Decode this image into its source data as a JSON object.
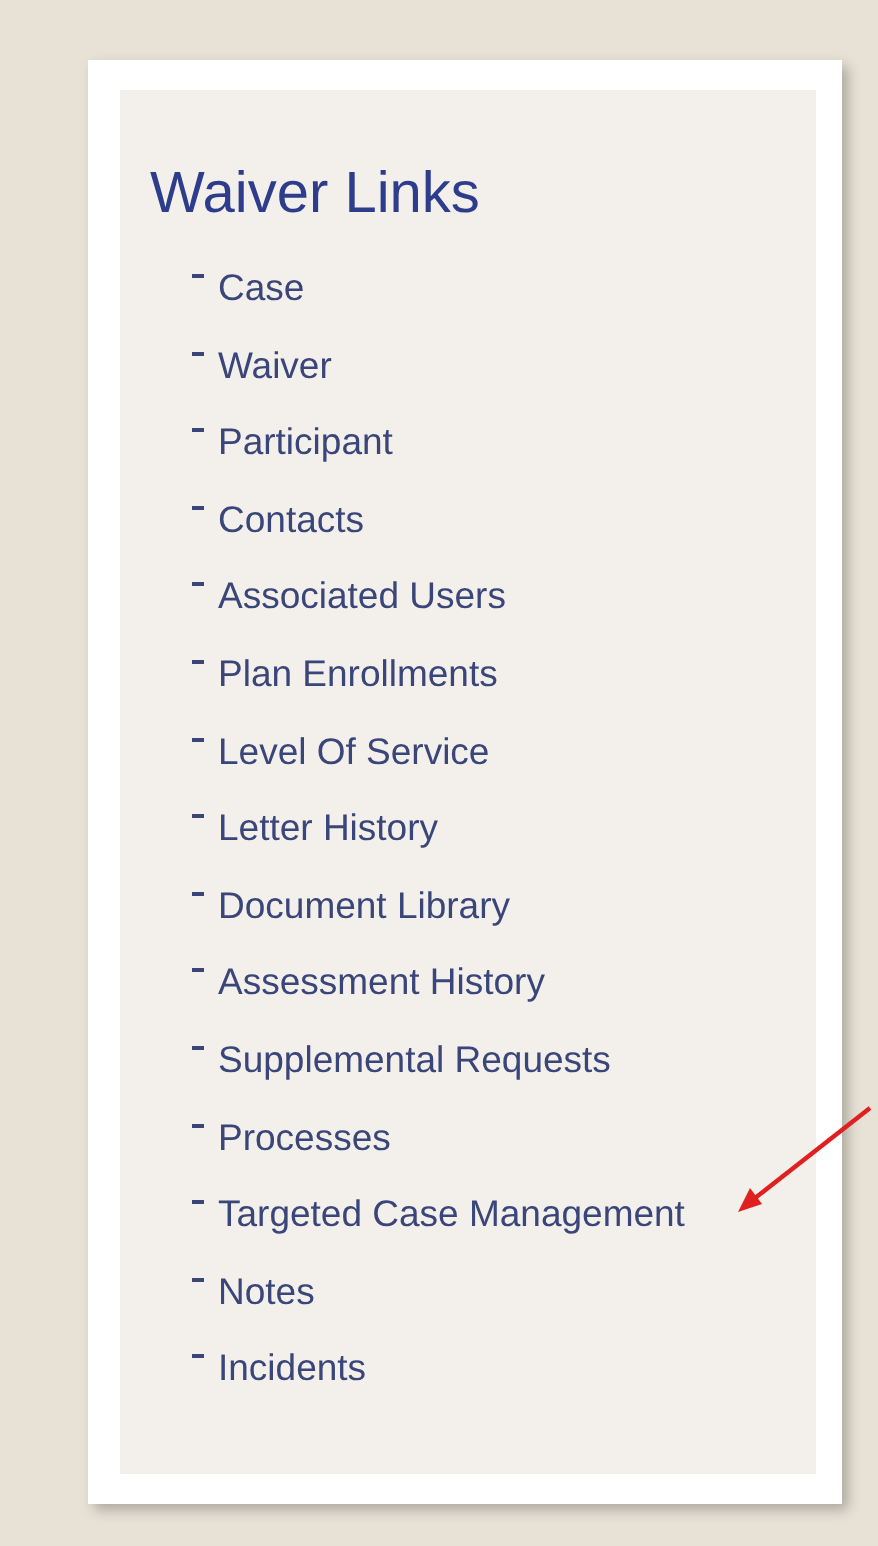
{
  "panel": {
    "title": "Waiver Links",
    "links": [
      {
        "label": "Case"
      },
      {
        "label": "Waiver"
      },
      {
        "label": "Participant"
      },
      {
        "label": "Contacts"
      },
      {
        "label": "Associated Users"
      },
      {
        "label": "Plan Enrollments"
      },
      {
        "label": "Level Of Service"
      },
      {
        "label": "Letter History"
      },
      {
        "label": "Document Library"
      },
      {
        "label": "Assessment History"
      },
      {
        "label": "Supplemental Requests"
      },
      {
        "label": "Processes"
      },
      {
        "label": "Targeted Case Management"
      },
      {
        "label": "Notes"
      },
      {
        "label": "Incidents"
      }
    ]
  }
}
